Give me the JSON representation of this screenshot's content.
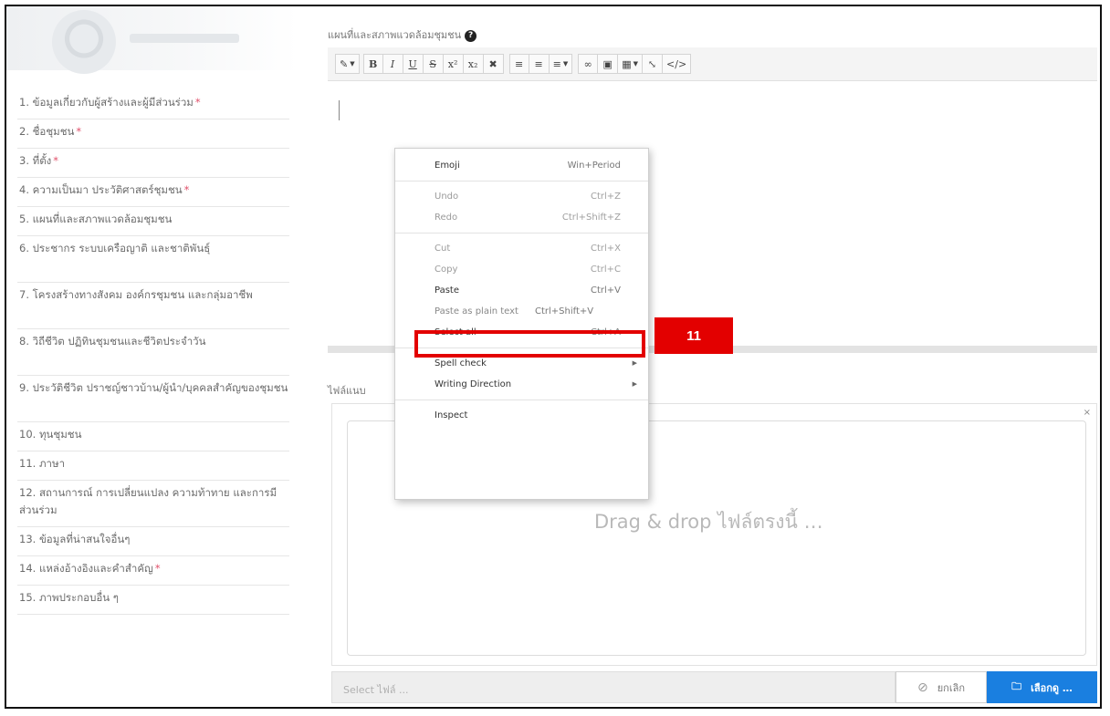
{
  "sidebar": {
    "items": [
      {
        "label": "1. ข้อมูลเกี่ยวกับผู้สร้างและผู้มีส่วนร่วม",
        "required": "*"
      },
      {
        "label": "2. ชื่อชุมชน",
        "required": "*"
      },
      {
        "label": "3. ที่ตั้ง",
        "required": "*"
      },
      {
        "label": "4. ความเป็นมา ประวัติศาสตร์ชุมชน",
        "required": "*"
      },
      {
        "label": "5. แผนที่และสภาพแวดล้อมชุมชน",
        "required": ""
      },
      {
        "label": "6. ประชากร ระบบเครือญาติ และชาติพันธุ์",
        "required": ""
      },
      {
        "label": "7. โครงสร้างทางสังคม องค์กรชุมชน และกลุ่มอาชีพ",
        "required": ""
      },
      {
        "label": "8. วิถีชีวิต ปฏิทินชุมชนและชีวิตประจำวัน",
        "required": ""
      },
      {
        "label": "9. ประวัติชีวิต ปราชญ์ชาวบ้าน/ผู้นำ/บุคคลสำคัญของชุมชน",
        "required": ""
      },
      {
        "label": "10. ทุนชุมชน",
        "required": ""
      },
      {
        "label": "11. ภาษา",
        "required": ""
      },
      {
        "label": "12. สถานการณ์ การเปลี่ยนแปลง ความท้าทาย และการมีส่วนร่วม",
        "required": ""
      },
      {
        "label": "13. ข้อมูลที่น่าสนใจอื่นๆ",
        "required": ""
      },
      {
        "label": "14. แหล่งอ้างอิงและคำสำคัญ",
        "required": "*"
      },
      {
        "label": "15. ภาพประกอบอื่น ๆ",
        "required": ""
      }
    ]
  },
  "editor": {
    "label": "แผนที่และสภาพแวดล้อมชุมชน",
    "help_icon": "?",
    "toolbar": {
      "style": "✎",
      "bold": "B",
      "italic": "I",
      "underline": "U",
      "strike": "S",
      "superscript": "x²",
      "subscript": "x₂",
      "eraser": "✖",
      "ul": "≡",
      "ol": "≡",
      "align": "≡",
      "link": "∞",
      "image": "▣",
      "table": "▦",
      "fullscreen": "⤡",
      "code": "</>"
    }
  },
  "context_menu": {
    "items": [
      {
        "label": "Emoji",
        "shortcut": "Win+Period",
        "disabled": false
      },
      {
        "label": "Undo",
        "shortcut": "Ctrl+Z",
        "disabled": true
      },
      {
        "label": "Redo",
        "shortcut": "Ctrl+Shift+Z",
        "disabled": true
      },
      {
        "label": "Cut",
        "shortcut": "Ctrl+X",
        "disabled": true
      },
      {
        "label": "Copy",
        "shortcut": "Ctrl+C",
        "disabled": true
      },
      {
        "label": "Paste",
        "shortcut": "Ctrl+V",
        "disabled": false
      },
      {
        "label": "Paste as plain text",
        "shortcut": "Ctrl+Shift+V",
        "disabled": false
      },
      {
        "label": "Select all",
        "shortcut": "Ctrl+A",
        "disabled": false
      },
      {
        "label": "Spell check",
        "shortcut": "",
        "disabled": false
      },
      {
        "label": "Writing Direction",
        "shortcut": "",
        "disabled": false
      },
      {
        "label": "Inspect",
        "shortcut": "",
        "disabled": false
      }
    ]
  },
  "attachment": {
    "label": "ไฟล์แนบ",
    "drop_text": "Drag & drop ไฟล์ตรงนี้ …",
    "close": "×",
    "placeholder": "Select ไฟล์ ...",
    "cancel_label": "ยกเลิก",
    "browse_label": "เลือกดู …"
  },
  "annotation": {
    "step": "11",
    "color": "#e30000"
  }
}
